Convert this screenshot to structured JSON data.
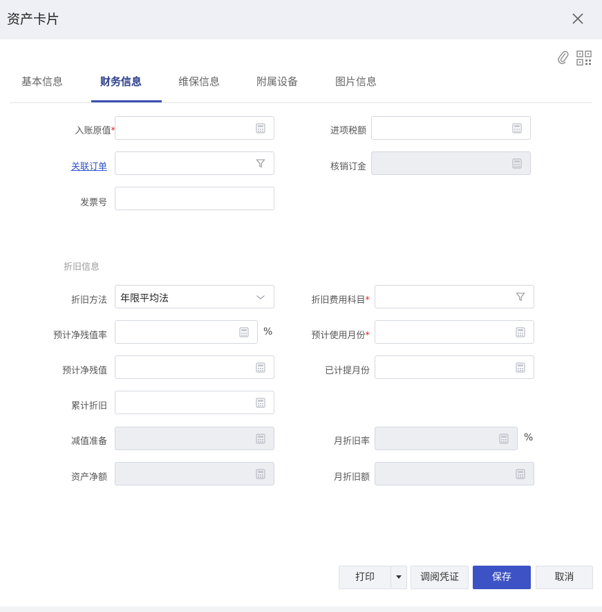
{
  "dialog": {
    "title": "资产卡片"
  },
  "tabs": [
    {
      "label": "基本信息"
    },
    {
      "label": "财务信息"
    },
    {
      "label": "维保信息"
    },
    {
      "label": "附属设备"
    },
    {
      "label": "图片信息"
    }
  ],
  "fields": {
    "original_value": {
      "label": "入账原值",
      "value": ""
    },
    "input_tax": {
      "label": "进项税额",
      "value": ""
    },
    "related_order": {
      "label": "关联订单",
      "value": ""
    },
    "writeoff_amount": {
      "label": "核销订金",
      "value": ""
    },
    "invoice_no": {
      "label": "发票号",
      "value": ""
    },
    "depr_method": {
      "label": "折旧方法",
      "value": "年限平均法"
    },
    "depr_account": {
      "label": "折旧费用科目",
      "value": ""
    },
    "residual_rate": {
      "label": "预计净残值率",
      "value": "",
      "unit": "%"
    },
    "useful_months": {
      "label": "预计使用月份",
      "value": ""
    },
    "residual_value": {
      "label": "预计净残值",
      "value": ""
    },
    "accrued_months": {
      "label": "已计提月份",
      "value": ""
    },
    "accum_depr": {
      "label": "累计折旧",
      "value": ""
    },
    "impairment": {
      "label": "减值准备",
      "value": ""
    },
    "monthly_rate": {
      "label": "月折旧率",
      "value": "",
      "unit": "%"
    },
    "net_value": {
      "label": "资产净额",
      "value": ""
    },
    "monthly_amount": {
      "label": "月折旧额",
      "value": ""
    }
  },
  "section": {
    "depreciation": "折旧信息"
  },
  "buttons": {
    "print": "打印",
    "view_voucher": "调阅凭证",
    "save": "保存",
    "cancel": "取消"
  },
  "colors": {
    "accent": "#3d52c4",
    "link": "#3153c4",
    "required": "#e02020"
  },
  "icons": {
    "close": "close-icon",
    "attach": "paperclip-icon",
    "qr": "qr-code-icon",
    "calculator": "calculator-icon",
    "filter": "filter-icon",
    "dropdown": "chevron-down-icon"
  }
}
